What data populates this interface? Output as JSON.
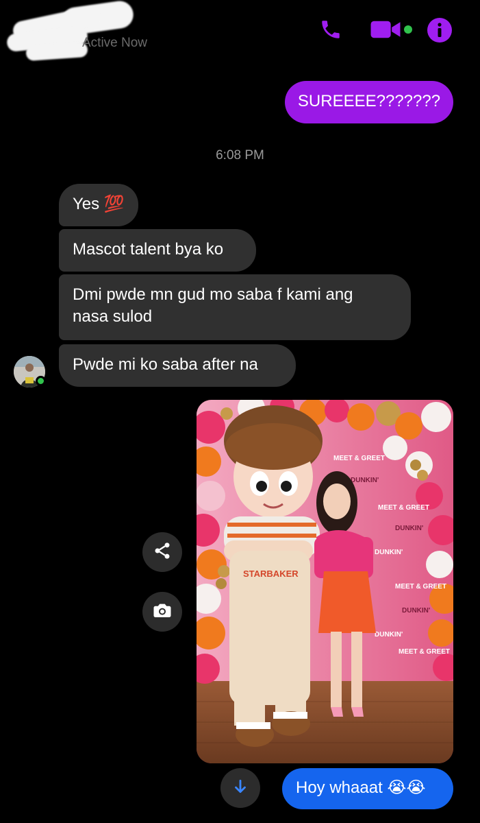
{
  "header": {
    "contact_name": "",
    "status": "Active Now",
    "icons": [
      "phone-icon",
      "video-call-icon",
      "info-icon"
    ],
    "accent_color": "#9a19e6",
    "online_color": "#31c24d"
  },
  "messages": {
    "out_1": "SUREEEE???????",
    "timestamp": "6:08 PM",
    "in_1": "Yes 💯",
    "in_2": "Mascot talent bya ko",
    "in_3_line1": "Dmi pwde mn gud mo saba f kami ang",
    "in_3_line2": "nasa sulod",
    "in_4": "Pwde mi ko saba after na",
    "out_2": "Hoy whaaat 😭😭"
  },
  "photo": {
    "sign_texts": [
      "MEET & GREET",
      "DUNKIN'",
      "STARBAKER"
    ]
  },
  "actions": {
    "share_icon": "share-icon",
    "camera_icon": "camera-icon",
    "scroll_down_icon": "arrow-down-icon"
  },
  "colors": {
    "outgoing_bubble": "#9a19e6",
    "outgoing_latest_bubble": "#1565ee",
    "incoming_bubble": "#303030"
  }
}
